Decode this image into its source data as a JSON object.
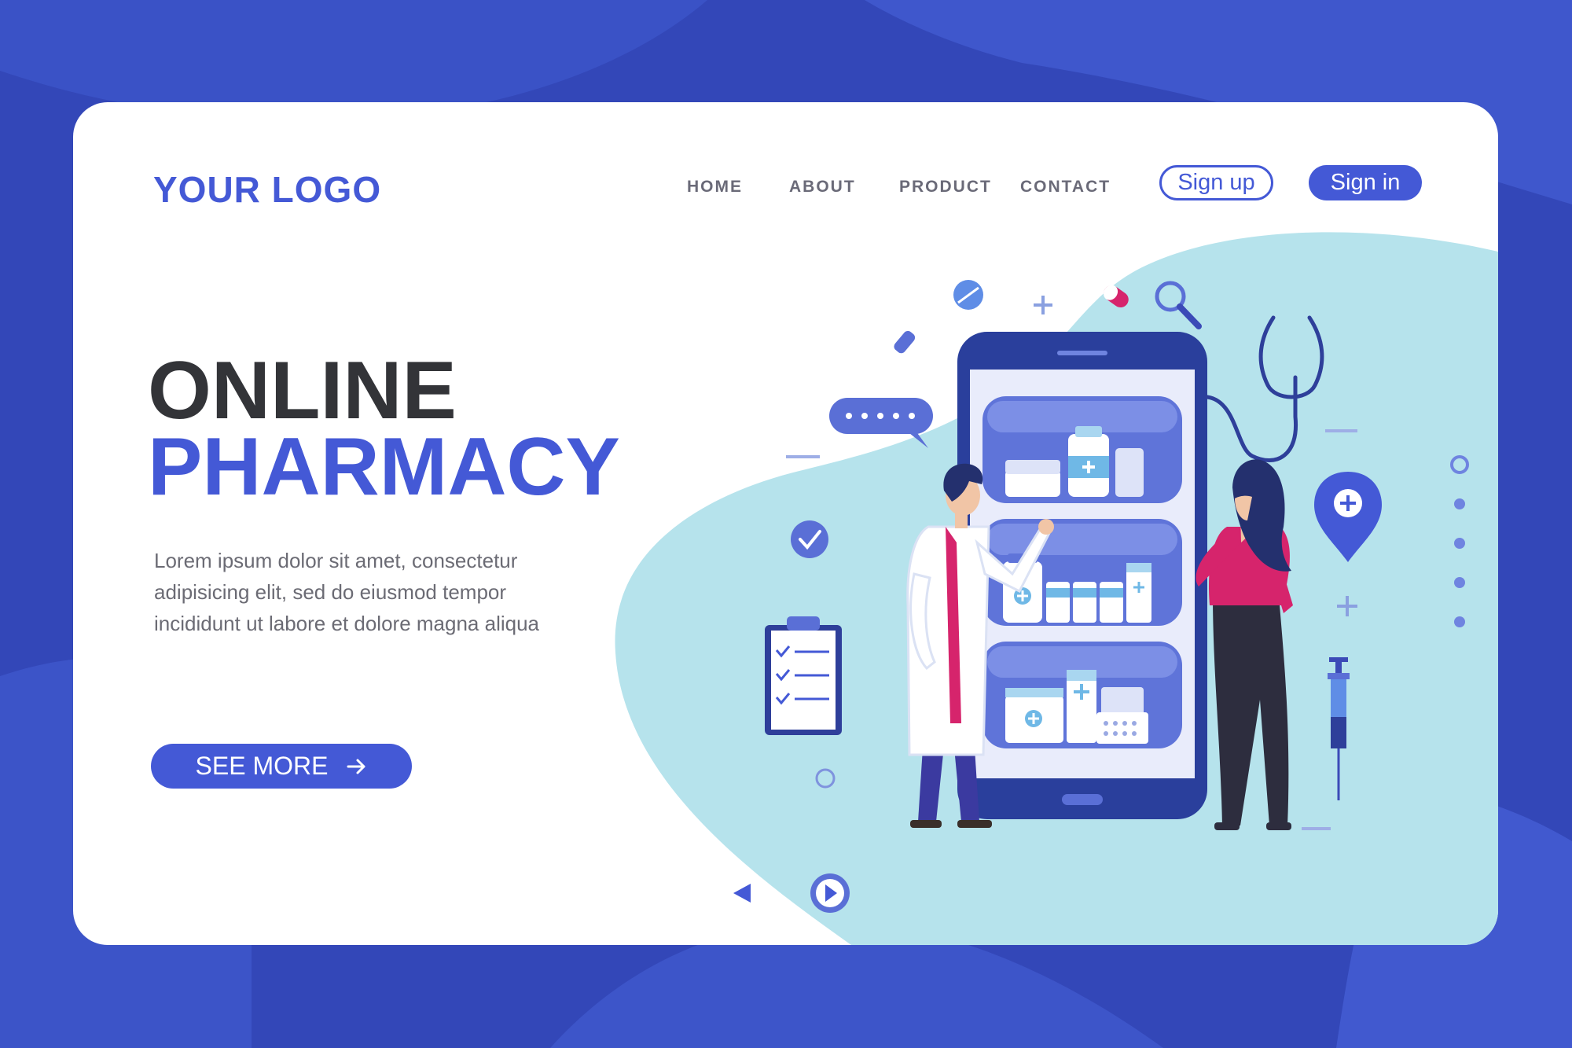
{
  "header": {
    "logo": "YOUR LOGO",
    "nav": [
      {
        "label": "HOME"
      },
      {
        "label": "ABOUT"
      },
      {
        "label": "PRODUCT"
      },
      {
        "label": "CONTACT"
      }
    ],
    "signup_label": "Sign up",
    "signin_label": "Sign in"
  },
  "hero": {
    "title_line1": "ONLINE",
    "title_line2": "PHARMACY",
    "description_lines": [
      "Lorem ipsum dolor sit amet, consectetur",
      "adipisicing elit, sed do eiusmod tempor",
      "incididunt ut labore et dolore magna aliqua"
    ],
    "cta_label": "SEE MORE",
    "cta_icon": "arrow-right-icon"
  },
  "colors": {
    "brand": "#4459d6",
    "background": "#3347b8",
    "dark_text": "#333438",
    "light_blob": "#b6e3ec",
    "pink": "#d6246c"
  },
  "illustration": {
    "icons": [
      "phone-icon",
      "doctor-figure",
      "patient-figure",
      "stethoscope-icon",
      "magnifier-icon",
      "pill-icon",
      "capsule-icon",
      "syringe-icon",
      "clipboard-icon",
      "location-pin-icon",
      "check-icon",
      "chat-bubble-icon",
      "play-icon",
      "prev-icon"
    ]
  }
}
